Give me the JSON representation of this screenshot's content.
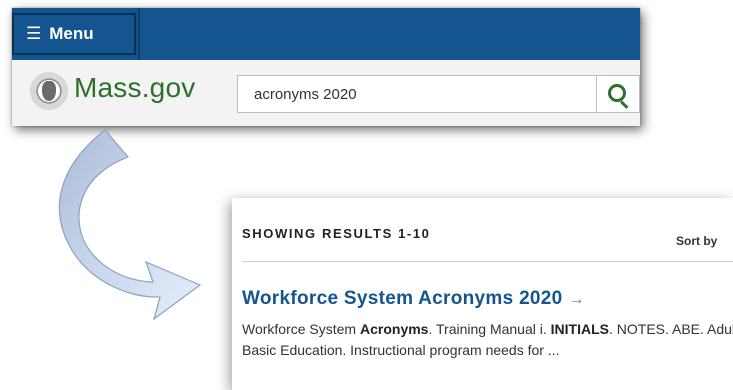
{
  "header": {
    "menu_label": "Menu",
    "logo_text": "Mass.gov",
    "search_value": "acronyms 2020",
    "icons": {
      "menu": "hamburger-icon",
      "seal": "state-seal-icon",
      "search": "search-icon"
    },
    "colors": {
      "topbar": "#14558f",
      "logo": "#2f6f2d",
      "brandbar": "#f3f3f3"
    }
  },
  "results": {
    "showing_label": "SHOWING RESULTS 1-10",
    "sort_label": "Sort by",
    "first_result": {
      "title": "Workforce System Acronyms 2020",
      "title_arrow": "→",
      "snippet": {
        "p1": "Workforce System ",
        "b1": "Acronyms",
        "p2": ". Training Manual i. ",
        "b2": "INITIALS",
        "p3": ". NOTES. ABE. Adult Basic Education. Instructional program needs for ..."
      }
    },
    "colors": {
      "title": "#14558f"
    }
  }
}
